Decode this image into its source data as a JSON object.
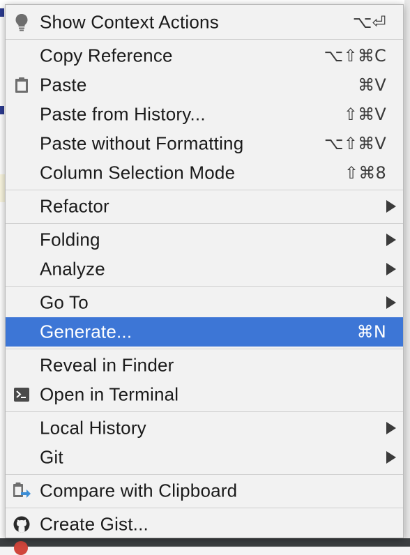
{
  "menu": {
    "items": [
      {
        "label": "Show Context Actions",
        "shortcut": "⌥⏎",
        "icon": "lightbulb-icon"
      },
      {
        "label": "Copy Reference",
        "shortcut": "⌥⇧⌘C"
      },
      {
        "label": "Paste",
        "shortcut": "⌘V",
        "icon": "clipboard-icon"
      },
      {
        "label": "Paste from History...",
        "shortcut": "⇧⌘V"
      },
      {
        "label": "Paste without Formatting",
        "shortcut": "⌥⇧⌘V"
      },
      {
        "label": "Column Selection Mode",
        "shortcut": "⇧⌘8"
      },
      {
        "label": "Refactor",
        "submenu": true
      },
      {
        "label": "Folding",
        "submenu": true
      },
      {
        "label": "Analyze",
        "submenu": true
      },
      {
        "label": "Go To",
        "submenu": true
      },
      {
        "label": "Generate...",
        "shortcut": "⌘N",
        "selected": true
      },
      {
        "label": "Reveal in Finder"
      },
      {
        "label": "Open in Terminal",
        "icon": "terminal-icon"
      },
      {
        "label": "Local History",
        "submenu": true
      },
      {
        "label": "Git",
        "submenu": true
      },
      {
        "label": "Compare with Clipboard",
        "icon": "compare-clipboard-icon"
      },
      {
        "label": "Create Gist...",
        "icon": "github-icon"
      }
    ]
  },
  "colors": {
    "selection": "#3d76d6",
    "menu_background": "#f2f2f2",
    "separator": "#d0d0d0"
  }
}
